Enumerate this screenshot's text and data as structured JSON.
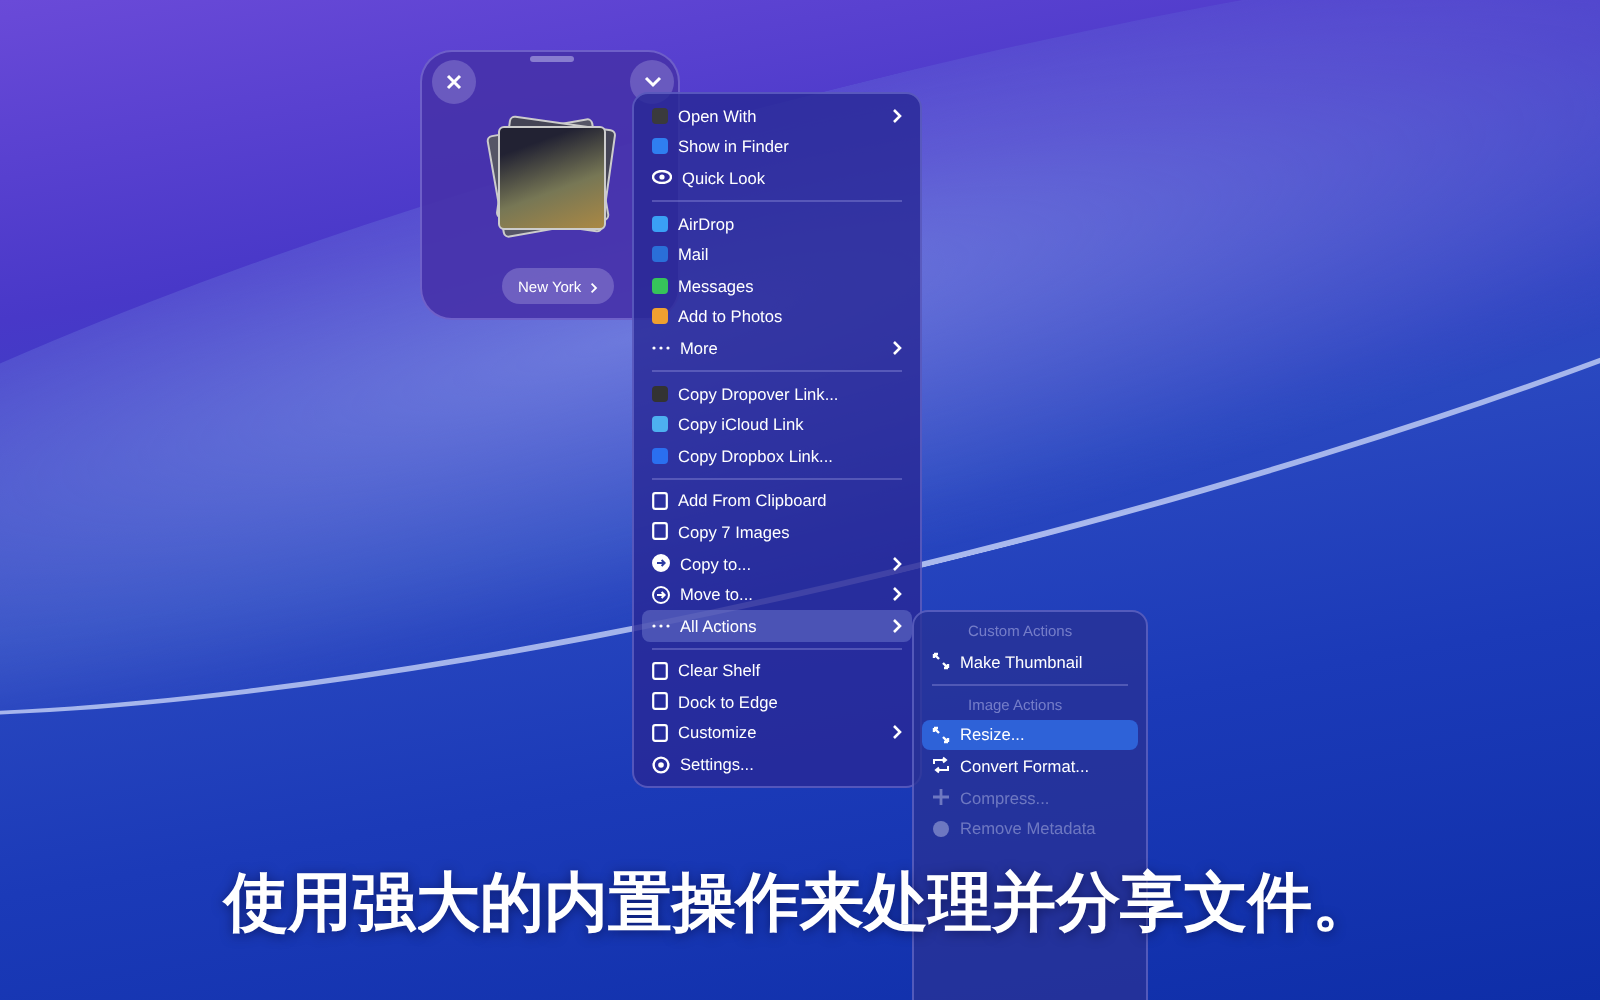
{
  "shelf": {
    "file_label": "New York"
  },
  "menu": {
    "sections": [
      [
        {
          "label": "Open With",
          "submenu": true,
          "selected": false
        },
        {
          "label": "Show in Finder",
          "submenu": false,
          "selected": false
        },
        {
          "label": "Quick Look",
          "submenu": false,
          "selected": false
        }
      ],
      [
        {
          "label": "AirDrop",
          "submenu": false,
          "selected": false
        },
        {
          "label": "Mail",
          "submenu": false,
          "selected": false
        },
        {
          "label": "Messages",
          "submenu": false,
          "selected": false
        },
        {
          "label": "Add to Photos",
          "submenu": false,
          "selected": false
        },
        {
          "label": "More",
          "submenu": true,
          "selected": false
        }
      ],
      [
        {
          "label": "Copy Dropover Link...",
          "submenu": false,
          "selected": false
        },
        {
          "label": "Copy iCloud Link",
          "submenu": false,
          "selected": false
        },
        {
          "label": "Copy Dropbox Link...",
          "submenu": false,
          "selected": false
        }
      ],
      [
        {
          "label": "Add From Clipboard",
          "submenu": false,
          "selected": false
        },
        {
          "label": "Copy 7 Images",
          "submenu": false,
          "selected": false
        },
        {
          "label": "Copy to...",
          "submenu": true,
          "selected": false
        },
        {
          "label": "Move to...",
          "submenu": true,
          "selected": false
        },
        {
          "label": "All Actions",
          "submenu": true,
          "selected": true
        }
      ],
      [
        {
          "label": "Clear Shelf",
          "submenu": false,
          "selected": false
        },
        {
          "label": "Dock to Edge",
          "submenu": false,
          "selected": false
        },
        {
          "label": "Customize",
          "submenu": true,
          "selected": false
        },
        {
          "label": "Settings...",
          "submenu": false,
          "selected": false
        }
      ]
    ]
  },
  "submenu": {
    "sections": [
      {
        "heading": "Custom Actions",
        "items": [
          {
            "label": "Make Thumbnail",
            "selected": false,
            "disabled": false
          }
        ]
      },
      {
        "heading": "Image Actions",
        "items": [
          {
            "label": "Resize...",
            "selected": true,
            "disabled": false
          },
          {
            "label": "Convert Format...",
            "selected": false,
            "disabled": false
          },
          {
            "label": "Compress...",
            "selected": false,
            "disabled": true
          },
          {
            "label": "Remove Metadata",
            "selected": false,
            "disabled": true
          }
        ]
      }
    ]
  },
  "caption": "使用强大的内置操作来处理并分享文件。"
}
